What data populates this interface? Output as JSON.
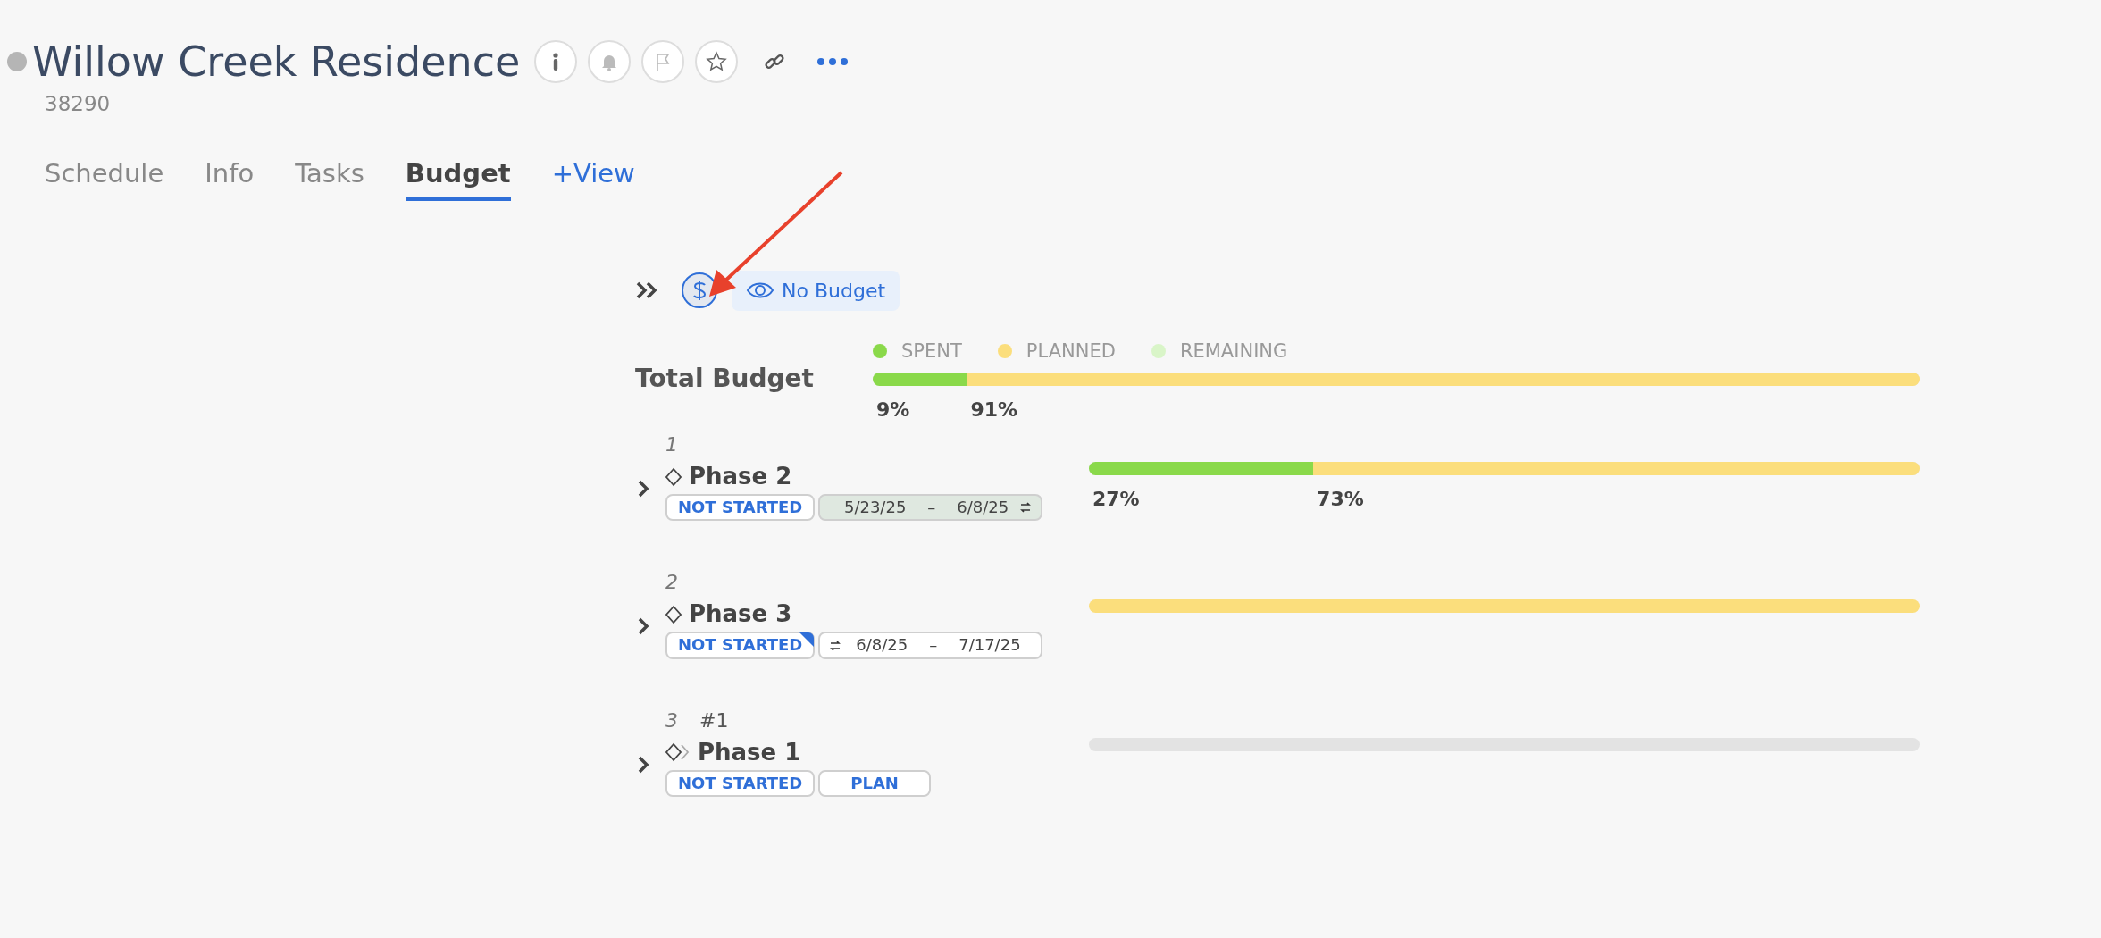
{
  "project": {
    "title": "Willow Creek Residence",
    "id": "38290"
  },
  "tabs": [
    {
      "label": "Schedule",
      "selected": false,
      "kind": "tab"
    },
    {
      "label": "Info",
      "selected": false,
      "kind": "tab"
    },
    {
      "label": "Tasks",
      "selected": false,
      "kind": "tab"
    },
    {
      "label": "Budget",
      "selected": true,
      "kind": "tab"
    },
    {
      "label": "+View",
      "selected": false,
      "kind": "add"
    }
  ],
  "toolbar": {
    "filter_label": "No Budget"
  },
  "legend": [
    {
      "label": "SPENT",
      "color": "#8ad94a"
    },
    {
      "label": "PLANNED",
      "color": "#fbde7c"
    },
    {
      "label": "REMAINING",
      "color": "#d9f5c8"
    }
  ],
  "total": {
    "label": "Total Budget",
    "segments": [
      {
        "level": 0.09,
        "color": "#8ad94a",
        "label": "9%"
      },
      {
        "level": 0.91,
        "color": "#fbde7c",
        "label": "91%"
      }
    ]
  },
  "phases": [
    {
      "number": "1",
      "name": "Phase 2",
      "kind": "diamond",
      "badges": [
        {
          "kind": "status",
          "text": "NOT STARTED",
          "flagged": false
        },
        {
          "kind": "dates",
          "start": "5/23/25",
          "sep": "–",
          "end": "6/8/25",
          "icon_first": false,
          "highlighted": true
        }
      ],
      "segments": [
        {
          "level": 0.27,
          "color": "#8ad94a",
          "label": "27%"
        },
        {
          "level": 0.73,
          "color": "#fbde7c",
          "label": "73%"
        }
      ]
    },
    {
      "number": "2",
      "name": "Phase 3",
      "kind": "diamond",
      "badges": [
        {
          "kind": "status",
          "text": "NOT STARTED",
          "flagged": true
        },
        {
          "kind": "dates",
          "start": "6/8/25",
          "sep": "–",
          "end": "7/17/25",
          "icon_first": true,
          "highlighted": false
        }
      ],
      "segments": [
        {
          "level": 1,
          "color": "#fbde7c"
        }
      ]
    },
    {
      "number": "3",
      "tag": "#1",
      "name": "Phase 1",
      "kind": "linked-diamond",
      "badges": [
        {
          "kind": "status",
          "text": "NOT STARTED",
          "flagged": false
        },
        {
          "kind": "plan",
          "text": "PLAN"
        }
      ]
    }
  ]
}
